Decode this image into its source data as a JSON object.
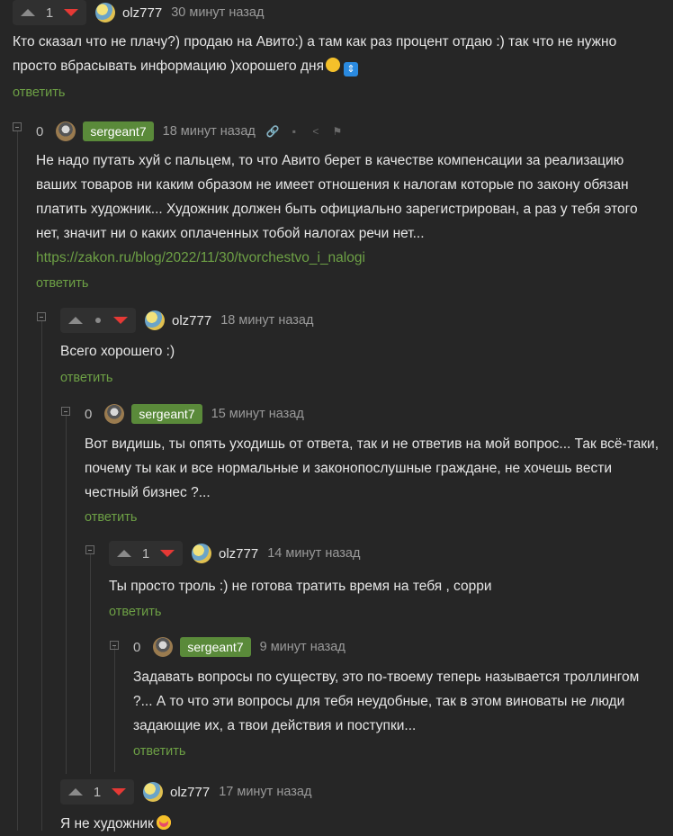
{
  "comments": [
    {
      "id": "c1",
      "rating": "1",
      "author": "olz777",
      "time": "30 минут назад",
      "text": "Кто сказал что не плачу?) продаю на Авито:) а там как раз процент отдаю :) так что не нужно просто вбрасывать информацию )хорошего дня",
      "reply": "ответить"
    },
    {
      "id": "c2",
      "rating": "0",
      "author": "sergeant7",
      "time": "18 минут назад",
      "text": "Не надо путать хуй с пальцем, то что Авито берет в качестве компенсации за реализацию ваших товаров ни каким образом не имеет отношения к налогам которые по закону обязан платить художник... Художник должен быть официально зарегистрирован, а раз у тебя этого нет, значит ни о каких оплаченных тобой налогах речи нет...",
      "link": "https://zakon.ru/blog/2022/11/30/tvorchestvo_i_nalogi",
      "reply": "ответить"
    },
    {
      "id": "c3",
      "rating": "",
      "author": "olz777",
      "time": "18 минут назад",
      "text": "Всего хорошего :)",
      "reply": "ответить"
    },
    {
      "id": "c4",
      "rating": "0",
      "author": "sergeant7",
      "time": "15 минут назад",
      "text": "Вот видишь, ты опять уходишь от ответа, так и не ответив на мой вопрос... Так всё-таки, почему ты как и все нормальные и законопослушные граждане, не хочешь вести честный бизнес ?...",
      "reply": "ответить"
    },
    {
      "id": "c5",
      "rating": "1",
      "author": "olz777",
      "time": "14 минут назад",
      "text": "Ты просто троль :) не готова тратить время на тебя , сорри",
      "reply": "ответить"
    },
    {
      "id": "c6",
      "rating": "0",
      "author": "sergeant7",
      "time": "9 минут назад",
      "text": "Задавать вопросы по существу, это по-твоему теперь называется троллингом ?... А то что эти вопросы для тебя неудобные, так в этом виноваты не люди задающие их, а твои действия и поступки...",
      "reply": "ответить"
    },
    {
      "id": "c7",
      "rating": "1",
      "author": "olz777",
      "time": "17 минут назад",
      "text": "Я не художник"
    }
  ],
  "icons": {
    "upvote": "triangle-up-icon",
    "downvote": "triangle-down-icon",
    "collapse": "minus-square-icon",
    "link": "link-icon",
    "save": "save-icon",
    "share": "share-icon",
    "report": "flag-icon"
  },
  "colors": {
    "background": "#262626",
    "reply_link": "#6da045",
    "downvote": "#e53935",
    "author_badge": "#5a8a3a"
  }
}
